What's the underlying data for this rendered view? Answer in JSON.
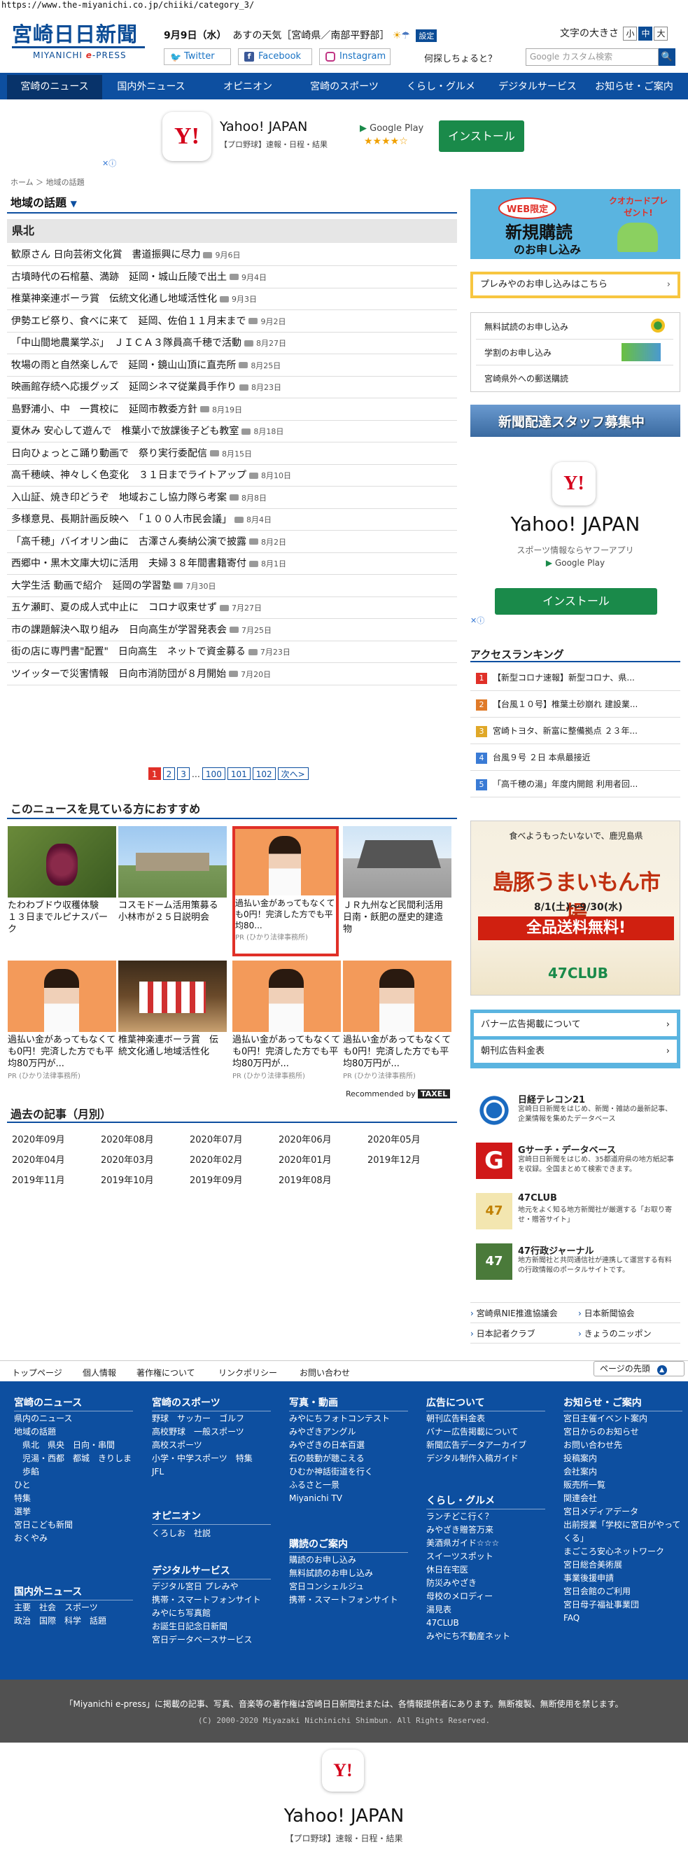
{
  "url": "https://www.the-miyanichi.co.jp/chiiki/category_3/",
  "logo": {
    "jp": "宮崎日日新聞",
    "en_pre": "MIYANICHI ",
    "en_e": "e",
    "en_post": "-PRESS"
  },
  "header": {
    "date": "9月9日（水）",
    "weather": "あすの天気［宮崎県／南部平野部］",
    "settings": "設定",
    "font_label": "文字の大きさ",
    "font_small": "小",
    "font_mid": "中",
    "font_large": "大",
    "twitter": "Twitter",
    "facebook": "Facebook",
    "instagram": "Instagram",
    "search_ask": "何探しちょると？",
    "search_placeholder": "Google カスタム検索",
    "search_btn": "🔍"
  },
  "nav": [
    "宮崎のニュース",
    "国内外ニュース",
    "オピニオン",
    "宮崎のスポーツ",
    "くらし・グルメ",
    "デジタルサービス",
    "お知らせ・ご案内"
  ],
  "ad1": {
    "name": "Yahoo! JAPAN",
    "sub": "【プロ野球】速報・日程・結果",
    "store": "Google Play",
    "stars": "★★★★☆",
    "install": "インストール"
  },
  "breadcrumb": {
    "home": "ホーム",
    "sep": "＞",
    "cur": "地域の話題"
  },
  "section_title": "地域の話題",
  "region": "県北",
  "articles": [
    {
      "t": "歓原さん 日向芸術文化賞　書道振興に尽力",
      "d": "9月6日"
    },
    {
      "t": "古墳時代の石棺墓、満跡　延岡・城山丘陵で出土",
      "d": "9月4日"
    },
    {
      "t": "椎葉神楽連ボーラ賞　伝統文化通し地域活性化",
      "d": "9月3日"
    },
    {
      "t": "伊勢エビ祭り、食べに来て　延岡、佐伯１１月末まで",
      "d": "9月2日"
    },
    {
      "t": "「中山間地農業学ぶ」　ＪＩＣＡ３隊員高千穂で活動",
      "d": "8月27日"
    },
    {
      "t": "牧場の雨と自然楽しんで　延岡・鏡山山頂に直売所",
      "d": "8月25日"
    },
    {
      "t": "映画館存続へ応援グッズ　延岡シネマ従業員手作り",
      "d": "8月23日"
    },
    {
      "t": "島野浦小、中　一貫校に　延岡市教委方針",
      "d": "8月19日"
    },
    {
      "t": "夏休み 安心して遊んで　椎葉小で放課後子ども教室",
      "d": "8月18日"
    },
    {
      "t": "日向ひょっとこ踊り動画で　祭り実行委配信",
      "d": "8月15日"
    },
    {
      "t": "高千穂峡、神々しく色変化　３１日までライトアップ",
      "d": "8月10日"
    },
    {
      "t": "入山証、焼き印どうぞ　地域おこし協力隊ら考案",
      "d": "8月8日"
    },
    {
      "t": "多様意見、長期計画反映へ　「１００人市民会議」",
      "d": "8月4日"
    },
    {
      "t": "「高千穂」バイオリン曲に　古澤さん奏納公演で披露",
      "d": "8月2日"
    },
    {
      "t": "西郷中・黒木文庫大切に活用　夫婦３８年間書籍寄付",
      "d": "8月1日"
    },
    {
      "t": "大学生活 動画で紹介　延岡の学習塾",
      "d": "7月30日"
    },
    {
      "t": "五ケ瀬町、夏の成人式中止に　コロナ収束せず",
      "d": "7月27日"
    },
    {
      "t": "市の課題解決へ取り組み　日向高生が学習発表会",
      "d": "7月25日"
    },
    {
      "t": "街の店に専門書\"配置\"　日向高生　ネットで資金募る",
      "d": "7月23日"
    },
    {
      "t": "ツイッターで災害情報　日向市消防団が８月開始",
      "d": "7月20日"
    }
  ],
  "pager": [
    "1",
    "2",
    "3",
    "…",
    "100",
    "101",
    "102",
    "次へ>"
  ],
  "rec_title": "このニュースを見ている方におすすめ",
  "rec_cards": [
    {
      "t": "たわわブドウ収穫体験　１３日までルピナスパーク",
      "pr": ""
    },
    {
      "t": "コスモドーム活用策募る　小林市が２５日説明会",
      "pr": ""
    },
    {
      "t": "過払い金があってもなくても0円！完済した方でも平均80...",
      "pr": "PR (ひかり法律事務所)"
    },
    {
      "t": "ＪＲ九州など民間利活用　日南・飫肥の歴史的建造物",
      "pr": ""
    },
    {
      "t": "過払い金があってもなくても0円！完済した方でも平均80万円が...",
      "pr": "PR (ひかり法律事務所)"
    },
    {
      "t": "椎葉神楽連ボーラ賞　伝統文化通し地域活性化",
      "pr": ""
    },
    {
      "t": "過払い金があってもなくても0円！完済した方でも平均80万円が...",
      "pr": "PR (ひかり法律事務所)"
    },
    {
      "t": "過払い金があってもなくても0円！完済した方でも平均80万円が...",
      "pr": "PR (ひかり法律事務所)"
    }
  ],
  "recommended_by": "Recommended by",
  "taxel": "TAXEL",
  "past_title": "過去の記事（月別）",
  "months": [
    "2020年09月",
    "2020年08月",
    "2020年07月",
    "2020年06月",
    "2020年05月",
    "2020年04月",
    "2020年03月",
    "2020年02月",
    "2020年01月",
    "2019年12月",
    "2019年11月",
    "2019年10月",
    "2019年09月",
    "2019年08月"
  ],
  "right": {
    "web_badge": "WEB限定",
    "quocard": "クオカードプレゼント!",
    "new_sub": "新規購読",
    "new_sub2": "のお申し込み",
    "premiya": "プレみやのお申し込みはこちら",
    "links1": [
      "無料試読のお申し込み",
      "学割のお申し込み",
      "宮崎県外への郵送購読"
    ],
    "staff": "新聞配達スタッフ募集中",
    "y_title": "Yahoo! JAPAN",
    "y_sub": "スポーツ情報ならヤフーアプリ",
    "y_store": "Google Play",
    "y_install": "インストール",
    "rank_title": "アクセスランキング",
    "ranks": [
      "【新型コロナ速報】新型コロナ、県...",
      "【台風１０号】椎葉土砂崩れ 建設業...",
      "宮崎トヨタ、新富に整備拠点 ２３年...",
      "台風９号 ２日 本県最接近",
      "「高千穂の湯」年度内開館 利用者回..."
    ],
    "rank_colors": [
      "#e03028",
      "#e07a28",
      "#e0a828",
      "#3a7bd5",
      "#3a7bd5"
    ],
    "banner_big": "島豚うまいもん市場",
    "banner_sale": "全品送料無料!",
    "banner_date": "8/1(土)〜9/30(水)",
    "banner_club": "47CLUB",
    "banner_top": "食べようもったいないで、鹿児島県",
    "adlinks": [
      "バナー広告掲載について",
      "朝刊広告料金表"
    ],
    "svcs": [
      {
        "t": "日経テレコン21",
        "d": "宮崎日日新聞をはじめ、新聞・雑誌の最新記事、企業情報を集めたデータベース"
      },
      {
        "t": "Gサーチ・データベース",
        "d": "宮崎日日新聞をはじめ、35都道府県の地方紙記事を収録。全国まとめて検索できます。"
      },
      {
        "t": "47CLUB",
        "d": "地元をよく知る地方新聞社が厳選する「お取り寄せ・贈答サイト」"
      },
      {
        "t": "47行政ジャーナル",
        "d": "地方新聞社と共同通信社が連携して運営する有料の行政情報のポータルサイトです。"
      }
    ],
    "bottom_links": [
      "宮崎県NIE推進協議会",
      "日本新聞協会",
      "日本記者クラブ",
      "きょうのニッポン"
    ]
  },
  "footbar": [
    "トップページ",
    "個人情報",
    "著作権について",
    "リンクポリシー",
    "お問い合わせ"
  ],
  "pagetop": "ページの先頭",
  "footer": {
    "c1_h": "宮崎のニュース",
    "c1": [
      "県内のニュース",
      "地域の話題",
      "　県北　県央　日向・串間",
      "　児湯・西都　都城　きりしま",
      "　歩餡",
      "ひと",
      "特集",
      "選挙",
      "宮日こども新聞",
      "おくやみ"
    ],
    "c1_h2": "国内外ニュース",
    "c1b": [
      "主要　社会　スポーツ",
      "政治　国際　科学　話題"
    ],
    "c2_h": "宮崎のスポーツ",
    "c2": [
      "野球　サッカー　ゴルフ",
      "高校野球　一般スポーツ",
      "高校スポーツ",
      "小学・中学スポーツ　特集",
      "JFL"
    ],
    "c2_h2": "オピニオン",
    "c2b": [
      "くろしお　社説"
    ],
    "c2_h3": "デジタルサービス",
    "c2c": [
      "デジタル宮日 プレみや",
      "携帯・スマートフォンサイト",
      "みやにち写真館",
      "お誕生日記念日新聞",
      "宮日データベースサービス"
    ],
    "c3_h": "写真・動画",
    "c3": [
      "みやにちフォトコンテスト",
      "みやざきアングル",
      "みやざきの日本百選",
      "石の鼓動が聴こえる",
      "ひむか神話街道を行く",
      "ふるさと一景",
      "Miyanichi TV"
    ],
    "c3_h2": "購読のご案内",
    "c3b": [
      "購読のお申し込み",
      "無料試読のお申し込み",
      "宮日コンシェルジュ",
      "携帯・スマートフォンサイト"
    ],
    "c4_h": "広告について",
    "c4": [
      "朝刊広告料金表",
      "バナー広告掲載について",
      "新聞広告データアーカイブ",
      "デジタル制作入稿ガイド"
    ],
    "c4_h2": "くらし・グルメ",
    "c4b": [
      "ランチどこ行く？",
      "みやざき贈答万来",
      "美酒県ガイド☆☆☆",
      "スイーツスポット",
      "休日在宅医",
      "防災みやざき",
      "母校のメロディー",
      "湯見表",
      "47CLUB",
      "みやにち不動産ネット"
    ],
    "c5_h": "お知らせ・ご案内",
    "c5": [
      "宮日主催イベント案内",
      "宮日からのお知らせ",
      "お問い合わせ先",
      "投稿案内",
      "会社案内",
      "販売所一覧",
      "関連会社",
      "宮日メディアデータ",
      "出前授業「学校に宮日がやってくる」",
      "まごころ安心ネットワーク",
      "宮日総合美術展",
      "事業後援申請",
      "宮日会館のご利用",
      "宮日母子福祉事業団",
      "FAQ"
    ]
  },
  "copy1": "「Miyanichi e-press」に掲載の記事、写真、音楽等の著作権は宮崎日日新聞社または、各情報提供者にあります。無断複製、無断使用を禁じます。",
  "copy2": "(C) 2000-2020 Miyazaki Nichinichi Shimbun. All Rights Reserved.",
  "bottom_ad": {
    "name": "Yahoo! JAPAN",
    "sub": "【プロ野球】速報・日程・結果"
  }
}
